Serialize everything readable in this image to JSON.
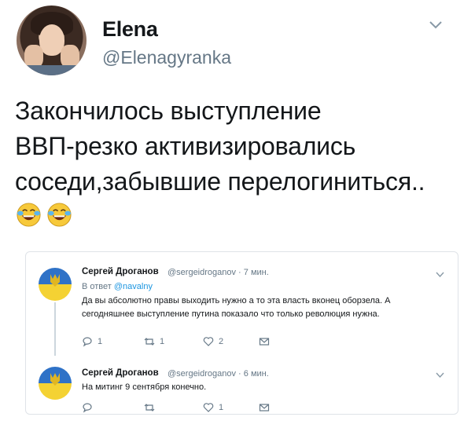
{
  "tweet": {
    "display_name": "Elena",
    "handle": "@Elenagyranka",
    "text_lines": [
      "Закончилось выступление",
      "ВВП-резко активизировались",
      "соседи,забывшие перелогиниться.."
    ],
    "emojis": [
      "tears-of-joy-emoji",
      "tears-of-joy-emoji"
    ]
  },
  "screenshot": {
    "replies": [
      {
        "name": "Сергей Дроганов",
        "meta": "@sergeidroganov · 7 мин.",
        "reply_prefix": "В ответ ",
        "reply_to": "@navalny",
        "text_lines": [
          "Да вы абсолютно правы выходить нужно а то эта власть вконец оборзела. А",
          "сегодняшнее выступление путина показало что только революция нужна."
        ],
        "actions": {
          "reply": "1",
          "retweet": "1",
          "like": "2"
        }
      },
      {
        "name": "Сергей Дроганов",
        "meta": "@sergeidroganov · 6 мин.",
        "text_lines": [
          "На митинг 9 сентября конечно."
        ],
        "actions": {
          "reply": "",
          "retweet": "",
          "like": "1"
        }
      }
    ]
  },
  "colors": {
    "text": "#14171a",
    "muted": "#657786",
    "link": "#1b95e0",
    "border": "#dfe3e8",
    "flag_blue": "#2f72c7",
    "flag_yellow": "#f4d233"
  }
}
